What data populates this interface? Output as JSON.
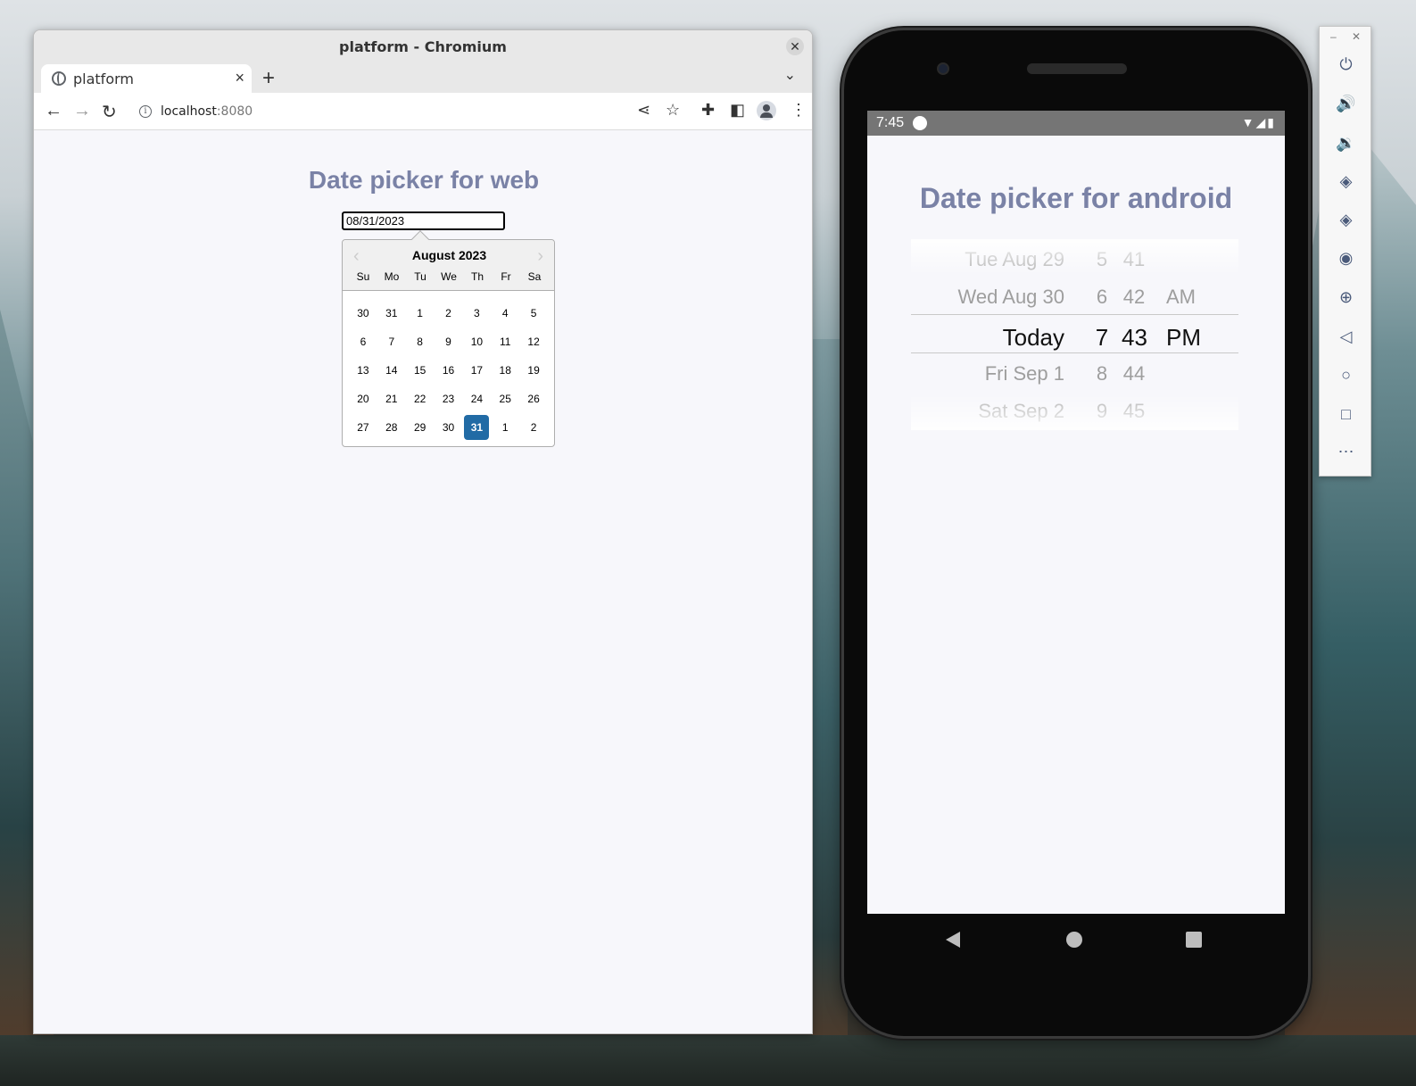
{
  "browser": {
    "window_title": "platform - Chromium",
    "tab_label": "platform",
    "url_host": "localhost",
    "url_port": ":8080"
  },
  "web_page": {
    "heading": "Date picker for web",
    "date_value": "08/31/2023",
    "calendar": {
      "month_title": "August 2023",
      "weekdays": [
        "Su",
        "Mo",
        "Tu",
        "We",
        "Th",
        "Fr",
        "Sa"
      ],
      "weeks": [
        [
          "30",
          "31",
          "1",
          "2",
          "3",
          "4",
          "5"
        ],
        [
          "6",
          "7",
          "8",
          "9",
          "10",
          "11",
          "12"
        ],
        [
          "13",
          "14",
          "15",
          "16",
          "17",
          "18",
          "19"
        ],
        [
          "20",
          "21",
          "22",
          "23",
          "24",
          "25",
          "26"
        ],
        [
          "27",
          "28",
          "29",
          "30",
          "31",
          "1",
          "2"
        ]
      ],
      "selected_day": "31"
    }
  },
  "android": {
    "status_time": "7:45",
    "heading": "Date picker for android",
    "picker_rows": [
      {
        "date": "Tue Aug 29",
        "hour": "5",
        "minute": "41",
        "ampm": ""
      },
      {
        "date": "Wed Aug 30",
        "hour": "6",
        "minute": "42",
        "ampm": "AM"
      },
      {
        "date": "Today",
        "hour": "7",
        "minute": "43",
        "ampm": "PM"
      },
      {
        "date": "Fri Sep 1",
        "hour": "8",
        "minute": "44",
        "ampm": ""
      },
      {
        "date": "Sat Sep 2",
        "hour": "9",
        "minute": "45",
        "ampm": ""
      }
    ]
  },
  "emulator_controls": [
    "power-icon",
    "volume-up-icon",
    "volume-down-icon",
    "rotate-left-icon",
    "rotate-right-icon",
    "camera-icon",
    "zoom-icon",
    "back-icon",
    "home-icon",
    "overview-icon",
    "more-icon"
  ]
}
